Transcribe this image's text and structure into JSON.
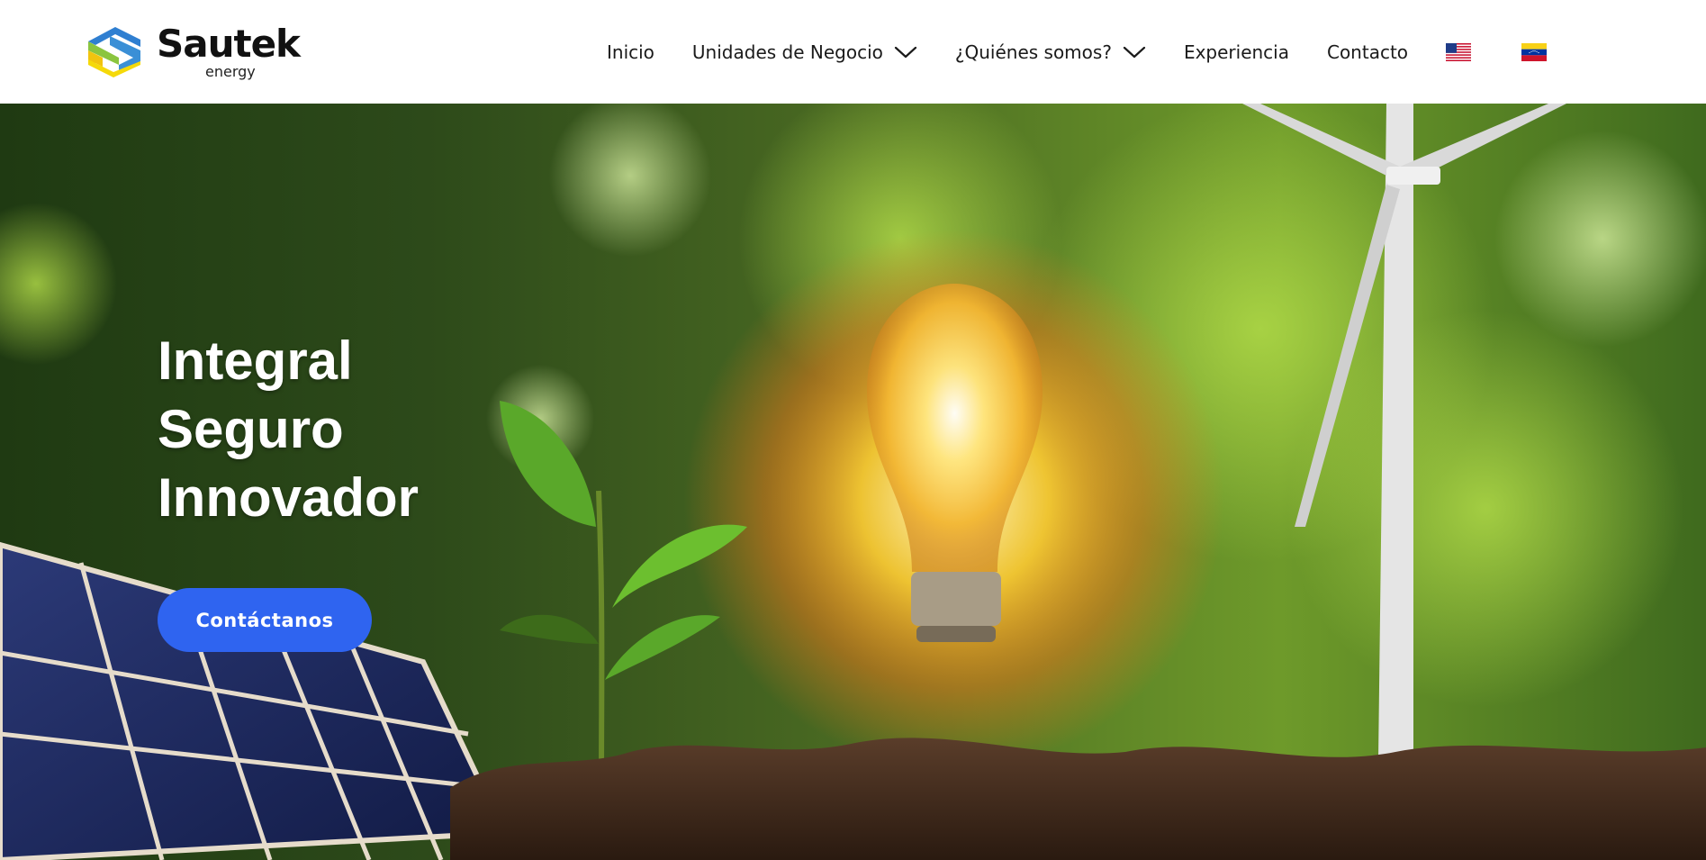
{
  "brand": {
    "name": "Sautek",
    "tagline": "energy",
    "colors": {
      "blue": "#2f7fd1",
      "yellow": "#f5d90a",
      "green": "#8bc53f"
    }
  },
  "nav": {
    "items": [
      {
        "label": "Inicio",
        "has_dropdown": false
      },
      {
        "label": "Unidades de Negocio",
        "has_dropdown": true
      },
      {
        "label": "¿Quiénes somos?",
        "has_dropdown": true
      },
      {
        "label": "Experiencia",
        "has_dropdown": false
      },
      {
        "label": "Contacto",
        "has_dropdown": false
      }
    ],
    "languages": [
      {
        "icon": "us-flag-icon"
      },
      {
        "icon": "venezuela-flag-icon"
      }
    ]
  },
  "hero": {
    "lines": [
      "Integral",
      "Seguro",
      "Innovador"
    ],
    "cta_label": "Contáctanos",
    "cta_color": "#2f64f0"
  }
}
